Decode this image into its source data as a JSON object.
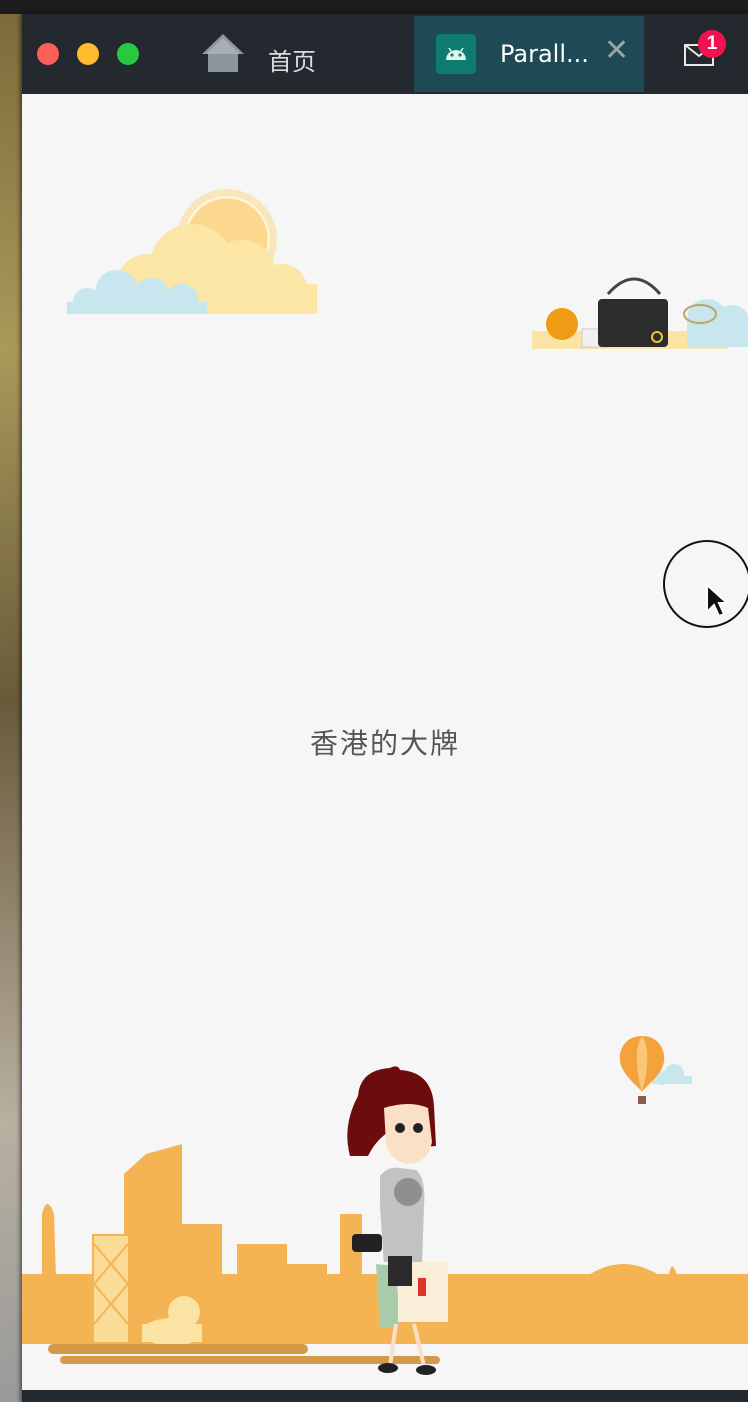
{
  "tabs": {
    "home_label": "首页",
    "active_label": "Parall...",
    "close_glyph": "✕"
  },
  "notifications": {
    "count": "1"
  },
  "page": {
    "center_text": "香港的大牌"
  },
  "icons": [
    "home-icon",
    "android-icon",
    "close-icon",
    "mail-icon",
    "cursor-icon"
  ],
  "colors": {
    "skyline": "#f4b454",
    "sun": "#f9d98c",
    "cloud_blue": "#c7e6ee",
    "titlebar": "#23292e",
    "active_tab": "#1d4a55",
    "badge": "#f0134f"
  }
}
